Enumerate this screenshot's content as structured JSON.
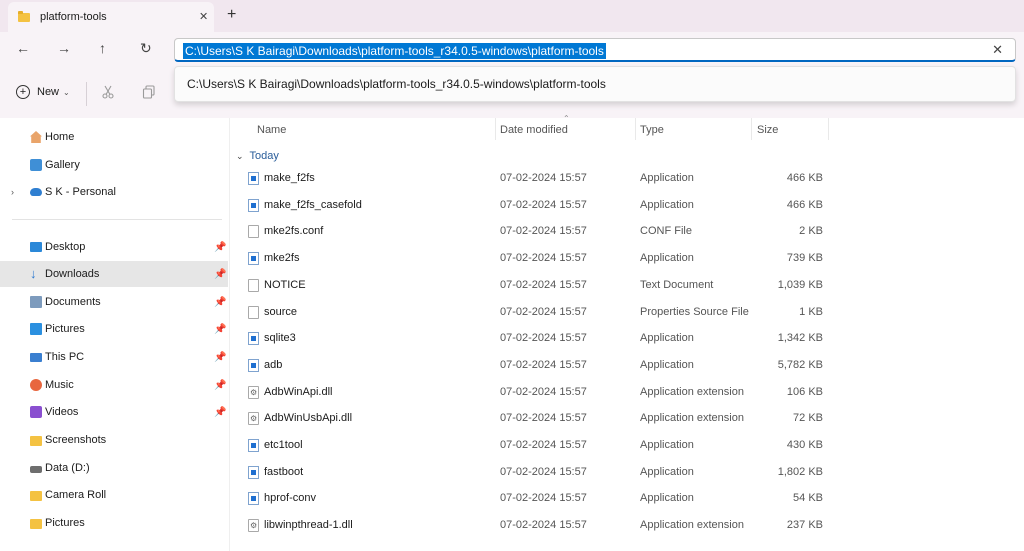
{
  "window": {
    "tab_title": "platform-tools",
    "close_tab_glyph": "✕",
    "new_tab_glyph": "+"
  },
  "nav": {
    "back_glyph": "←",
    "forward_glyph": "→",
    "up_glyph": "↑",
    "refresh_glyph": "↻"
  },
  "address_bar": {
    "value": "C:\\Users\\S K Bairagi\\Downloads\\platform-tools_r34.0.5-windows\\platform-tools",
    "clear_glyph": "✕",
    "suggestion": "C:\\Users\\S K Bairagi\\Downloads\\platform-tools_r34.0.5-windows\\platform-tools"
  },
  "toolbar": {
    "new_label": "New",
    "new_plus_glyph": "+",
    "new_chevron_glyph": "⌄",
    "cut_icon": "cut-icon",
    "copy_icon": "copy-icon"
  },
  "sidebar": {
    "pin_glyph": "📌",
    "expand_glyph": "›",
    "group_top": [
      {
        "label": "Home",
        "icon": "home-icon"
      },
      {
        "label": "Gallery",
        "icon": "gallery-icon"
      },
      {
        "label": "S K - Personal",
        "icon": "onedrive-icon"
      }
    ],
    "quick_access": [
      {
        "label": "Desktop",
        "icon": "desktop-icon"
      },
      {
        "label": "Downloads",
        "icon": "download-icon"
      },
      {
        "label": "Documents",
        "icon": "documents-icon"
      },
      {
        "label": "Pictures",
        "icon": "pictures-icon"
      },
      {
        "label": "This PC",
        "icon": "pc-icon"
      },
      {
        "label": "Music",
        "icon": "music-icon"
      },
      {
        "label": "Videos",
        "icon": "videos-icon"
      },
      {
        "label": "Screenshots",
        "icon": "folder-icon"
      },
      {
        "label": "Data (D:)",
        "icon": "drive-icon"
      },
      {
        "label": "Camera Roll",
        "icon": "folder-icon"
      },
      {
        "label": "Pictures",
        "icon": "folder-icon"
      }
    ],
    "selected": "Downloads"
  },
  "file_list": {
    "columns": {
      "name": "Name",
      "date": "Date modified",
      "type": "Type",
      "size": "Size"
    },
    "sort_caret": "⌃",
    "group_label": "Today",
    "group_chevron": "⌄",
    "rows": [
      {
        "name": "make_f2fs",
        "date": "07-02-2024 15:57",
        "type": "Application",
        "size": "466 KB",
        "icon": "app-icon"
      },
      {
        "name": "make_f2fs_casefold",
        "date": "07-02-2024 15:57",
        "type": "Application",
        "size": "466 KB",
        "icon": "app-icon"
      },
      {
        "name": "mke2fs.conf",
        "date": "07-02-2024 15:57",
        "type": "CONF File",
        "size": "2 KB",
        "icon": "file-icon"
      },
      {
        "name": "mke2fs",
        "date": "07-02-2024 15:57",
        "type": "Application",
        "size": "739 KB",
        "icon": "app-icon"
      },
      {
        "name": "NOTICE",
        "date": "07-02-2024 15:57",
        "type": "Text Document",
        "size": "1,039 KB",
        "icon": "text-file-icon"
      },
      {
        "name": "source",
        "date": "07-02-2024 15:57",
        "type": "Properties Source File",
        "size": "1 KB",
        "icon": "file-icon"
      },
      {
        "name": "sqlite3",
        "date": "07-02-2024 15:57",
        "type": "Application",
        "size": "1,342 KB",
        "icon": "app-icon"
      },
      {
        "name": "adb",
        "date": "07-02-2024 15:57",
        "type": "Application",
        "size": "5,782 KB",
        "icon": "app-icon"
      },
      {
        "name": "AdbWinApi.dll",
        "date": "07-02-2024 15:57",
        "type": "Application extension",
        "size": "106 KB",
        "icon": "dll-icon"
      },
      {
        "name": "AdbWinUsbApi.dll",
        "date": "07-02-2024 15:57",
        "type": "Application extension",
        "size": "72 KB",
        "icon": "dll-icon"
      },
      {
        "name": "etc1tool",
        "date": "07-02-2024 15:57",
        "type": "Application",
        "size": "430 KB",
        "icon": "app-icon"
      },
      {
        "name": "fastboot",
        "date": "07-02-2024 15:57",
        "type": "Application",
        "size": "1,802 KB",
        "icon": "app-icon"
      },
      {
        "name": "hprof-conv",
        "date": "07-02-2024 15:57",
        "type": "Application",
        "size": "54 KB",
        "icon": "app-icon"
      },
      {
        "name": "libwinpthread-1.dll",
        "date": "07-02-2024 15:57",
        "type": "Application extension",
        "size": "237 KB",
        "icon": "dll-icon"
      }
    ]
  },
  "colors": {
    "accent": "#0078d4",
    "chrome": "#f8f3f7",
    "selected_row": "#e6e6e6"
  }
}
